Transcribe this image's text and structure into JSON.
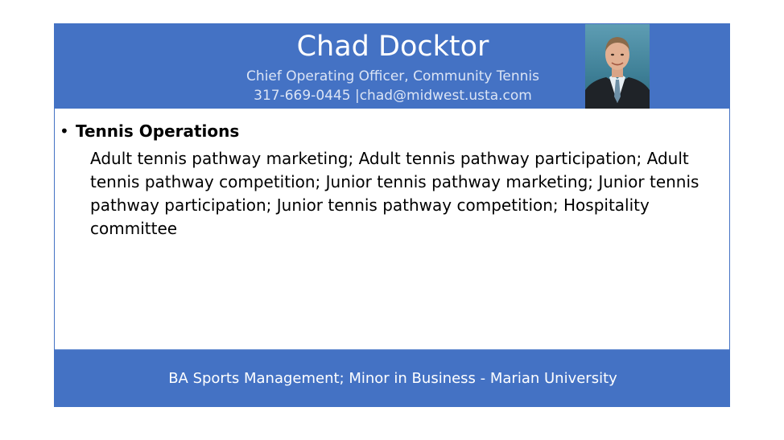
{
  "header": {
    "name": "Chad Docktor",
    "title": "Chief Operating Officer, Community Tennis",
    "contact": "317-669-0445 |chad@midwest.usta.com"
  },
  "photo": {
    "icon": "person-portrait-icon",
    "background_color": "#4e8ea6"
  },
  "content": {
    "bullet_symbol": "•",
    "heading": "Tennis Operations",
    "description": "Adult tennis pathway marketing; Adult tennis pathway participation; Adult tennis pathway competition; Junior tennis pathway marketing; Junior tennis pathway participation; Junior tennis pathway competition; Hospitality committee"
  },
  "footer": {
    "education": "BA Sports Management; Minor in Business - Marian University"
  },
  "colors": {
    "accent": "#4472c4",
    "header_text": "#ffffff",
    "subtext": "#dbe4f5"
  }
}
